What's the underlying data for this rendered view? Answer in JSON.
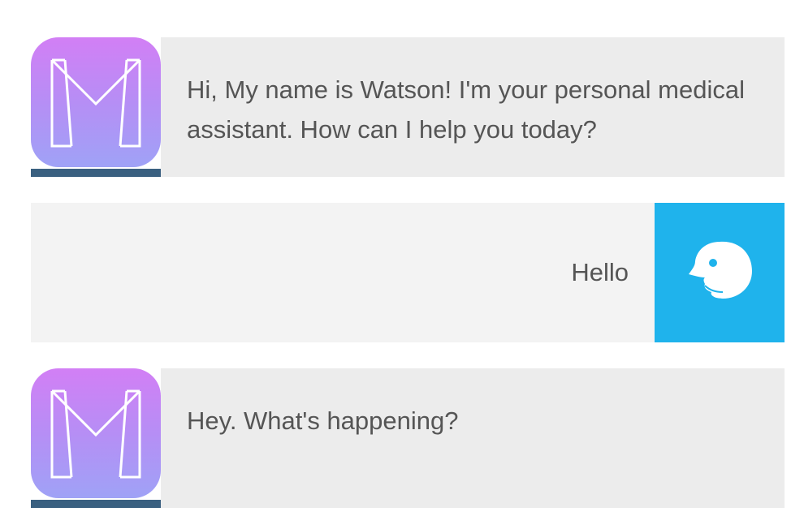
{
  "conversation": {
    "messages": [
      {
        "sender": "bot",
        "avatar_icon": "monogram-m-icon",
        "text": "Hi, My name is Watson! I'm your personal medical assistant. How can I help you today?"
      },
      {
        "sender": "user",
        "avatar_icon": "face-profile-icon",
        "text": "Hello"
      },
      {
        "sender": "bot",
        "avatar_icon": "monogram-m-icon",
        "text": "Hey. What's happening?"
      }
    ]
  },
  "colors": {
    "bot_avatar_gradient_top": "#d27ff5",
    "bot_avatar_gradient_bottom": "#9fa2f6",
    "bot_avatar_strip": "#3a6080",
    "bot_bubble_bg": "#ececec",
    "user_bubble_bg": "#f3f3f3",
    "user_avatar_bg": "#1fb3ec",
    "message_text": "#555555"
  }
}
